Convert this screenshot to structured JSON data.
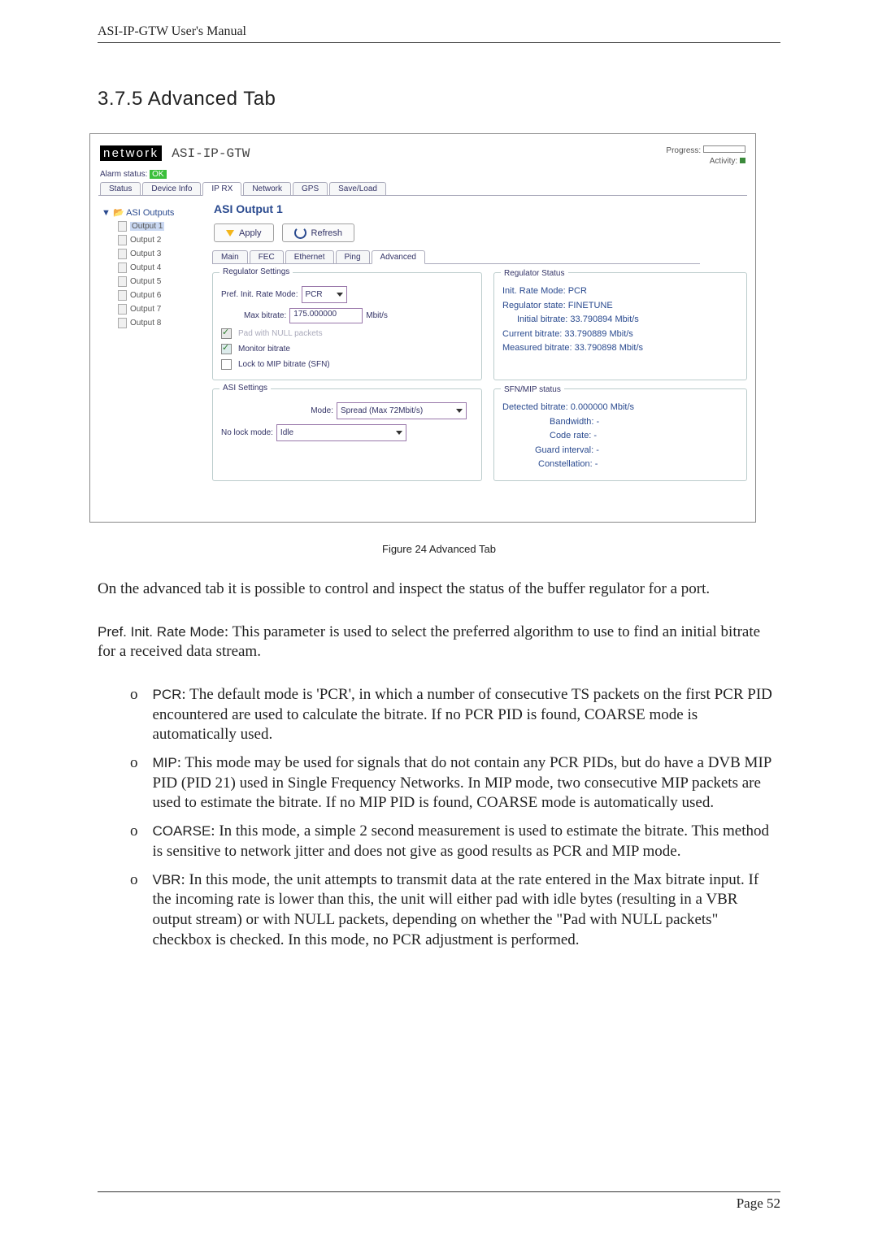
{
  "header_title": "ASI-IP-GTW User's Manual",
  "section_heading": "3.7.5 Advanced Tab",
  "figure": {
    "brand": "network",
    "device_name": "ASI-IP-GTW",
    "progress_label": "Progress:",
    "activity_label": "Activity:",
    "alarm_status_label": "Alarm status:",
    "alarm_status_value": "OK",
    "main_tabs": [
      "Status",
      "Device Info",
      "IP RX",
      "Network",
      "GPS",
      "Save/Load"
    ],
    "main_tab_active_index": 2,
    "tree_root": "ASI Outputs",
    "tree_items": [
      "Output 1",
      "Output 2",
      "Output 3",
      "Output 4",
      "Output 5",
      "Output 6",
      "Output 7",
      "Output 8"
    ],
    "tree_selected_index": 0,
    "pane_title": "ASI Output 1",
    "apply_btn": "Apply",
    "refresh_btn": "Refresh",
    "sub_tabs": [
      "Main",
      "FEC",
      "Ethernet",
      "Ping",
      "Advanced"
    ],
    "sub_tab_active_index": 4,
    "reg_settings": {
      "legend": "Regulator Settings",
      "pref_label": "Pref. Init. Rate Mode:",
      "pref_value": "PCR",
      "max_bitrate_label": "Max bitrate:",
      "max_bitrate_value": "175.000000",
      "max_bitrate_unit": "Mbit/s",
      "pad_null_label": "Pad with NULL packets",
      "monitor_bitrate_label": "Monitor bitrate",
      "lock_mip_label": "Lock to MIP bitrate (SFN)"
    },
    "reg_status": {
      "legend": "Regulator Status",
      "line1": "Init. Rate Mode: PCR",
      "line2": "Regulator state: FINETUNE",
      "line3": "Initial bitrate: 33.790894 Mbit/s",
      "line4": "Current bitrate: 33.790889 Mbit/s",
      "line5": "Measured bitrate: 33.790898 Mbit/s"
    },
    "asi_settings": {
      "legend": "ASI Settings",
      "mode_label": "Mode:",
      "mode_value": "Spread (Max 72Mbit/s)",
      "nolock_label": "No lock mode:",
      "nolock_value": "Idle"
    },
    "sfn": {
      "legend": "SFN/MIP status",
      "line1": "Detected bitrate: 0.000000 Mbit/s",
      "line2": "Bandwidth: -",
      "line3": "Code rate: -",
      "line4": "Guard interval: -",
      "line5": "Constellation: -"
    }
  },
  "caption": "Figure 24 Advanced Tab",
  "para1": "On the advanced tab it is possible to control and inspect the status of the buffer regulator for a port.",
  "pref_lead_label": "Pref. Init. Rate Mode",
  "pref_lead_rest": ": This parameter is used to select the preferred algorithm to use to find an initial bitrate for a received data stream.",
  "bullets": [
    {
      "label": "PCR",
      "text": ": The default mode is 'PCR', in which a number of consecutive TS packets on the first PCR PID encountered are used to calculate the bitrate. If no PCR PID is found, COARSE mode is automatically used."
    },
    {
      "label": "MIP",
      "text": ": This mode may be used for signals that do not contain any PCR PIDs, but do have a DVB MIP PID (PID 21) used in Single Frequency Networks. In MIP mode, two consecutive MIP packets are used to estimate the bitrate. If no MIP PID is found, COARSE mode is automatically used."
    },
    {
      "label": "COARSE",
      "text": ": In this mode, a simple 2 second measurement is used to estimate the bitrate. This method is sensitive to network jitter and does not give as good results as PCR and MIP mode."
    },
    {
      "label": "VBR",
      "text": ": In this mode, the unit attempts to transmit data at the rate entered in the Max bitrate input. If the incoming rate is lower than this, the unit will either pad with idle bytes (resulting in a VBR output stream) or with NULL packets, depending on whether the \"Pad with NULL packets\" checkbox is checked. In this mode, no PCR adjustment is performed."
    }
  ],
  "footer": "Page 52"
}
